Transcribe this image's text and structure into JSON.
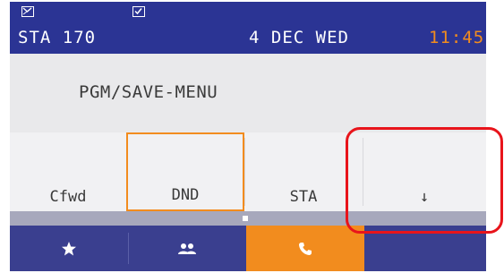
{
  "status_bar": {
    "station": "STA 170",
    "date": "4 DEC WED",
    "time": "11:45",
    "left_icon": "missed-call-icon",
    "mid_icon": "voicemail-icon"
  },
  "menu": {
    "title": "PGM/SAVE-MENU"
  },
  "softkeys": [
    {
      "label": "Cfwd"
    },
    {
      "label": "DND",
      "selected": true
    },
    {
      "label": "STA"
    },
    {
      "label": "↓"
    }
  ],
  "nav": [
    {
      "icon": "star-icon"
    },
    {
      "icon": "contacts-icon"
    },
    {
      "icon": "phone-icon",
      "active": true
    },
    {
      "icon": ""
    }
  ],
  "colors": {
    "status_bar": "#2b3494",
    "accent": "#f28c1e",
    "nav": "#3a3f8f",
    "highlight": "#e8141b"
  }
}
